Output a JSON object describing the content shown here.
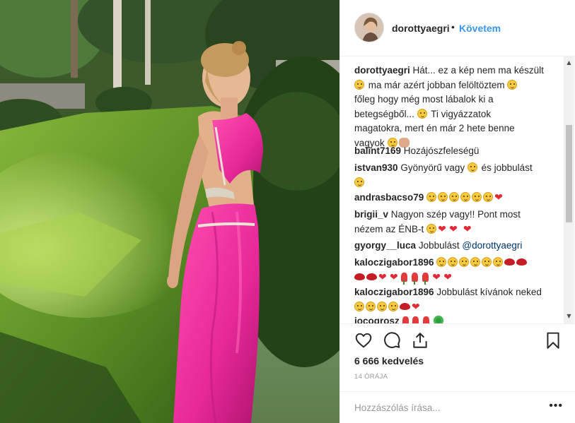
{
  "post": {
    "username": "dorottyaegri",
    "separator": "•",
    "follow_label": "Követem"
  },
  "comments": [
    {
      "user": "dorottyaegri",
      "lines": [
        "Hát... ez a kép nem ma készült",
        "ma már azért jobban felöltöztem",
        "főleg hogy még most lábalok ki a",
        "betegségből...",
        "Ti vigyázzatok",
        "magatokra, mert én már 2 hete benne",
        "vagyok"
      ]
    },
    {
      "user": "balint7169",
      "text": "Hozájószfeleségü"
    },
    {
      "user": "istvan930",
      "text": "Gyönyörű vagy",
      "text2": "és jobbulást"
    },
    {
      "user": "andrasbacso79",
      "text": ""
    },
    {
      "user": "brigii_v",
      "text": "Nagyon szép vagy!! Pont most",
      "text2": "nézem az ÉNB-t"
    },
    {
      "user": "gyorgy__luca",
      "text": "Jobbulást",
      "mention": "@dorottyaegri"
    },
    {
      "user": "kaloczigabor1896",
      "text": ""
    },
    {
      "user": "kaloczigabor1896",
      "text": "Jobbulást kívánok neked"
    },
    {
      "user": "jocogrosz",
      "text": ""
    }
  ],
  "actions": {
    "like_icon": "heart-icon",
    "comment_icon": "comment-icon",
    "share_icon": "share-icon",
    "save_icon": "bookmark-icon"
  },
  "likes_label": "6 666 kedvelés",
  "time_ago": "14 ÓRÁJA",
  "add_comment_placeholder": "Hozzászólás írása...",
  "more_label": "•••",
  "scrollbar": {
    "up": "▲",
    "down": "▼"
  },
  "colors": {
    "link": "#3897f0",
    "mention": "#003569",
    "dress": "#f0329a"
  }
}
